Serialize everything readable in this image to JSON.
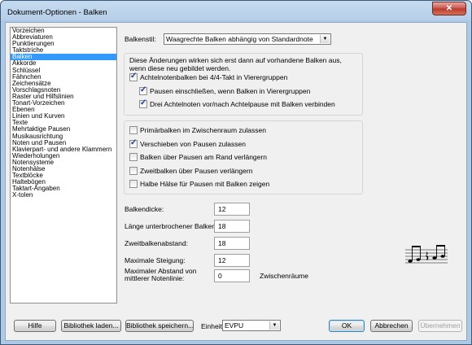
{
  "window": {
    "title": "Dokument-Optionen - Balken",
    "close_glyph": "✕"
  },
  "categories": [
    "Vorzeichen",
    "Abbreviaturen",
    "Punktierungen",
    "Taktstriche",
    "Balken",
    "Akkorde",
    "Schlüssel",
    "Fähnchen",
    "Zeichensätze",
    "Vorschlagsnoten",
    "Raster und Hilfslinien",
    "Tonart-Vorzeichen",
    "Ebenen",
    "Linien und Kurven",
    "Texte",
    "Mehrtaktige Pausen",
    "Musikausrichtung",
    "Noten und Pausen",
    "Klavierpart- und andere Klammern",
    "Wiederholungen",
    "Notensysteme",
    "Notenhälse",
    "Textblöcke",
    "Haltebögen",
    "Taktart-Angaben",
    "X-tolen"
  ],
  "selected_category": "Balken",
  "balkenstil": {
    "label": "Balkenstil:",
    "value": "Waagrechte Balken abhängig von Standardnote"
  },
  "info_text": "Diese Änderungen wirken sich erst dann auf vorhandene Balken aus, wenn diese neu gebildet werden.",
  "checks_top": [
    {
      "label": "Achtelnotenbalken bei 4/4-Takt in Vierergruppen",
      "checked": true
    },
    {
      "label": "Pausen einschließen, wenn Balken in Vierergruppen",
      "checked": true
    },
    {
      "label": "Drei Achtelnoten vor/nach Achtelpause mit Balken verbinden",
      "checked": true
    }
  ],
  "checks_group": [
    {
      "label": "Primärbalken im Zwischenraum zulassen",
      "checked": false
    },
    {
      "label": "Verschieben von Pausen zulassen",
      "checked": true
    },
    {
      "label": "Balken über Pausen am Rand verlängern",
      "checked": false
    },
    {
      "label": "Zweitbalken über Pausen verlängern",
      "checked": false
    },
    {
      "label": "Halbe Hälse für Pausen mit Balken zeigen",
      "checked": false
    }
  ],
  "fields": [
    {
      "label": "Balkendicke:",
      "value": "12"
    },
    {
      "label": "Länge unterbrochener Balken:",
      "value": "18"
    },
    {
      "label": "Zweitbalkenabstand:",
      "value": "18"
    },
    {
      "label": "Maximale Steigung:",
      "value": "12"
    }
  ],
  "max_distance": {
    "label_line1": "Maximaler Abstand von",
    "label_line2": "mittlerer Notenlinie:",
    "value": "0",
    "unit": "Zwischenräume"
  },
  "buttons": {
    "help": "Hilfe",
    "load_library": "Bibliothek laden...",
    "save_library": "Bibliothek speichern...",
    "unit_label": "Einheit:",
    "unit_value": "EVPU",
    "ok": "OK",
    "cancel": "Abbrechen",
    "apply": "Übernehmen"
  }
}
